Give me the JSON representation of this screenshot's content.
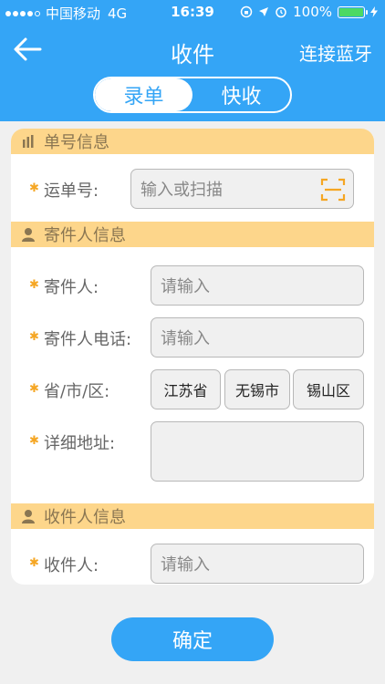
{
  "status_bar": {
    "carrier": "中国移动",
    "network": "4G",
    "time": "16:39",
    "battery": "100%",
    "battery_level": 1.0
  },
  "nav": {
    "title": "收件",
    "right_action": "连接蓝牙"
  },
  "segment": {
    "tabs": [
      "录单",
      "快收"
    ],
    "selected": 0
  },
  "sections": {
    "waybill": {
      "title": "单号信息",
      "waybill_label": "运单号:",
      "waybill_placeholder": "输入或扫描"
    },
    "sender": {
      "title": "寄件人信息",
      "name_label": "寄件人:",
      "name_placeholder": "请输入",
      "phone_label": "寄件人电话:",
      "phone_placeholder": "请输入",
      "region_label": "省/市/区:",
      "province": "江苏省",
      "city": "无锡市",
      "district": "锡山区",
      "address_label": "详细地址:"
    },
    "receiver": {
      "title": "收件人信息",
      "name_label": "收件人:",
      "name_placeholder": "请输入"
    }
  },
  "confirm_label": "确定",
  "colors": {
    "primary": "#34a5f6",
    "section_header": "#fdd68b",
    "required_star": "#f5a623"
  }
}
